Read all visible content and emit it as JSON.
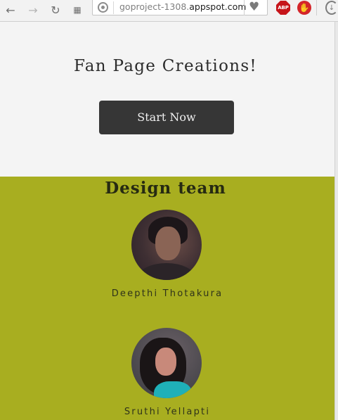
{
  "browser": {
    "url_dim": "goproject-1308.",
    "url_main": "appspot.com",
    "icons": {
      "back": "arrow-left-icon",
      "forward": "arrow-right-icon",
      "reload": "reload-icon",
      "apps": "apps-grid-icon",
      "site_info": "site-info-icon",
      "bookmark": "heart-icon",
      "adblock": "adblock-icon",
      "hand": "stop-hand-icon",
      "download": "download-icon"
    },
    "adblock_label": "ABP"
  },
  "hero": {
    "title": "Fan Page Creations!",
    "button_label": "Start Now"
  },
  "team": {
    "title": "Design team",
    "members": [
      {
        "name": "Deepthi Thotakura"
      },
      {
        "name": "Sruthi Yellapti"
      }
    ],
    "background_color": "#a8ae20"
  },
  "colors": {
    "hero_bg": "#f4f4f4",
    "button_bg": "#363636",
    "button_text": "#f0f0f0"
  }
}
